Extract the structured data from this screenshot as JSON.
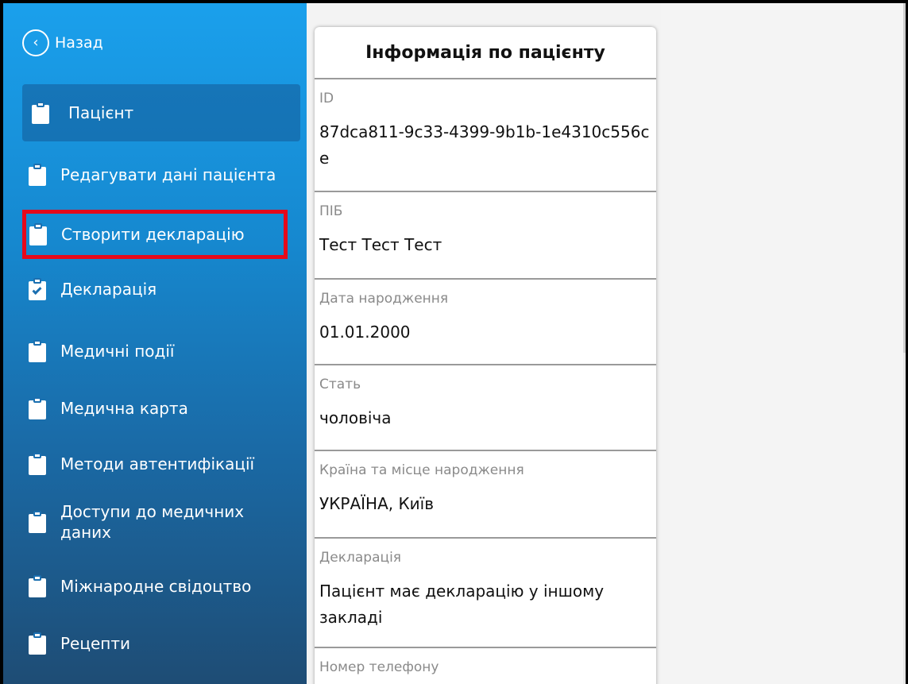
{
  "sidebar": {
    "back_label": "Назад",
    "items": [
      {
        "label": "Пацієнт",
        "icon": "clipboard-icon"
      },
      {
        "label": "Редагувати дані пацієнта",
        "icon": "clipboard-icon"
      },
      {
        "label": "Створити декларацію",
        "icon": "clipboard-icon"
      },
      {
        "label": "Декларація",
        "icon": "clipboard-check-icon"
      },
      {
        "label": "Медичні події",
        "icon": "clipboard-icon"
      },
      {
        "label": "Медична карта",
        "icon": "clipboard-icon"
      },
      {
        "label": "Методи автентифікації",
        "icon": "clipboard-icon"
      },
      {
        "label": "Доступи до медичних даних",
        "icon": "clipboard-icon"
      },
      {
        "label": "Міжнародне свідоцтво",
        "icon": "clipboard-icon"
      },
      {
        "label": "Рецепти",
        "icon": "clipboard-icon"
      }
    ],
    "colors": {
      "top": "#1aa0ec",
      "bottom": "#1e4c74",
      "highlight": "#e6091a"
    }
  },
  "card": {
    "title": "Інформація по пацієнту",
    "fields": [
      {
        "label": "ID",
        "value": "87dca811-9c33-4399-9b1b-1e4310c556ce"
      },
      {
        "label": "ПІБ",
        "value": "Тест Тест Тест"
      },
      {
        "label": "Дата народження",
        "value": "01.01.2000"
      },
      {
        "label": "Стать",
        "value": "чоловіча"
      },
      {
        "label": "Країна та місце народження",
        "value": "УКРАЇНА, Київ"
      },
      {
        "label": "Декларація",
        "value": "Пацієнт має декларацію у іншому закладі"
      },
      {
        "label": "Номер телефону",
        "value": ""
      }
    ]
  }
}
